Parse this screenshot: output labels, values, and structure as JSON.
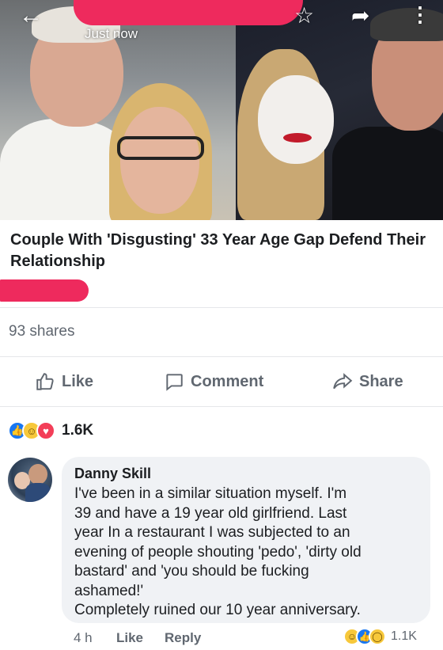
{
  "post": {
    "timestamp": "Just now",
    "headline": "Couple With 'Disgusting' 33 Year Age Gap Defend Their Relationship",
    "shares": "93 shares"
  },
  "actions": {
    "like": "Like",
    "comment": "Comment",
    "share": "Share"
  },
  "reactions": {
    "types": [
      "like",
      "haha",
      "love"
    ],
    "count": "1.6K"
  },
  "comment": {
    "author": "Danny Skill",
    "lines": [
      "I've been in a similar situation  myself. I'm",
      "39 and have a 19 year old girlfriend. Last",
      "year In a restaurant I was subjected to an",
      "evening of people shouting 'pedo', 'dirty old",
      "bastard' and 'you should be fucking",
      "ashamed!'",
      "Completely ruined our 10 year anniversary."
    ],
    "time": "4 h",
    "like_label": "Like",
    "reply_label": "Reply",
    "reaction_types": [
      "haha",
      "like",
      "wow"
    ],
    "reaction_count": "1.1K"
  },
  "icons": {
    "back": "back-arrow-icon",
    "star": "star-icon",
    "share": "share-arrow-icon",
    "more": "more-vertical-icon"
  },
  "colors": {
    "redaction": "#ee2a5d",
    "facebook_blue": "#1877f2",
    "secondary_text": "#606770"
  }
}
